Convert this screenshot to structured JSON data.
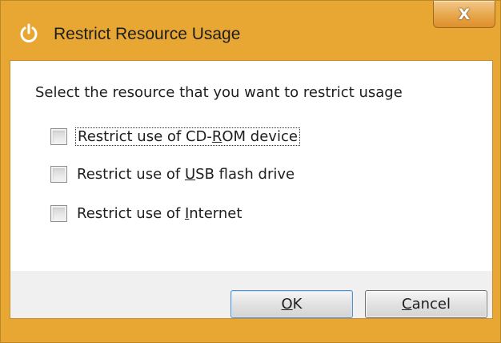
{
  "window": {
    "title": "Restrict Resource Usage",
    "app_icon": "power-icon",
    "close_glyph": "X",
    "accent_color": "#e8a733"
  },
  "dialog": {
    "prompt": "Select the resource that you want to restrict usage",
    "options": [
      {
        "label_pre": "Restrict use of CD-",
        "label_mn": "R",
        "label_post": "OM device",
        "checked": false
      },
      {
        "label_pre": "Restrict use of ",
        "label_mn": "U",
        "label_post": "SB flash drive",
        "checked": false
      },
      {
        "label_pre": "Restrict use of ",
        "label_mn": "I",
        "label_post": "nternet",
        "checked": false
      }
    ]
  },
  "buttons": {
    "ok": {
      "mn": "O",
      "rest": "K"
    },
    "cancel": {
      "mn": "C",
      "rest": "ancel"
    }
  }
}
